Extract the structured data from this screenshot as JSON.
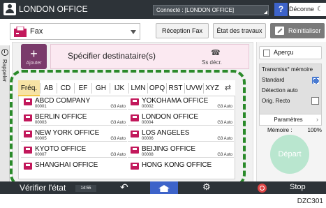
{
  "topbar": {
    "title": "LONDON OFFICE",
    "status": "Connecté : [LONDON OFFICE]",
    "help": "?",
    "disconnect": "Déconnexion"
  },
  "appbar": {
    "app": "Fax",
    "reception": "Réception Fax",
    "etat": "État des travaux",
    "reset": "Réinitialiser"
  },
  "recent_tab": "Rappeler",
  "destination": {
    "add_label": "Ajouter",
    "label": "Spécifier destinataire(s)",
    "phone_caption": "Ss décr."
  },
  "tabs": [
    "Fréq.",
    "AB",
    "CD",
    "EF",
    "GH",
    "IJK",
    "LMN",
    "OPQ",
    "RST",
    "UVW",
    "XYZ"
  ],
  "active_tab": "Fréq.",
  "entries": [
    {
      "name": "ABCD COMPANY",
      "num": "00001",
      "mode": "G3 Auto"
    },
    {
      "name": "YOKOHAMA OFFICE",
      "num": "00002",
      "mode": "G3 Auto"
    },
    {
      "name": "BERLIN OFFICE",
      "num": "00003",
      "mode": "G3 Auto"
    },
    {
      "name": "LONDON OFFICE",
      "num": "00004",
      "mode": "G3 Auto"
    },
    {
      "name": "NEW YORK OFFICE",
      "num": "00005",
      "mode": "G3 Auto"
    },
    {
      "name": "LOS ANGELES",
      "num": "00006",
      "mode": "G3 Auto"
    },
    {
      "name": "KYOTO OFFICE",
      "num": "00007",
      "mode": "G3 Auto"
    },
    {
      "name": "BEIJING OFFICE",
      "num": "00008",
      "mode": "G3 Auto"
    },
    {
      "name": "SHANGHAI  OFFICE",
      "num": "",
      "mode": ""
    },
    {
      "name": "HONG KONG OFFICE",
      "num": "",
      "mode": ""
    }
  ],
  "right": {
    "apercu": "Aperçu",
    "transmission": "Transmiss° mémoire",
    "standard": "Standard",
    "detection": "Détection auto",
    "orig": "Orig. Recto",
    "parametres": "Paramètres",
    "memory_label": "Mémoire :",
    "memory_value": "100%",
    "depart": "Départ"
  },
  "bottombar": {
    "check": "Vérifier l'état",
    "time": "14:55",
    "stop": "Stop"
  },
  "code": "DZC301"
}
